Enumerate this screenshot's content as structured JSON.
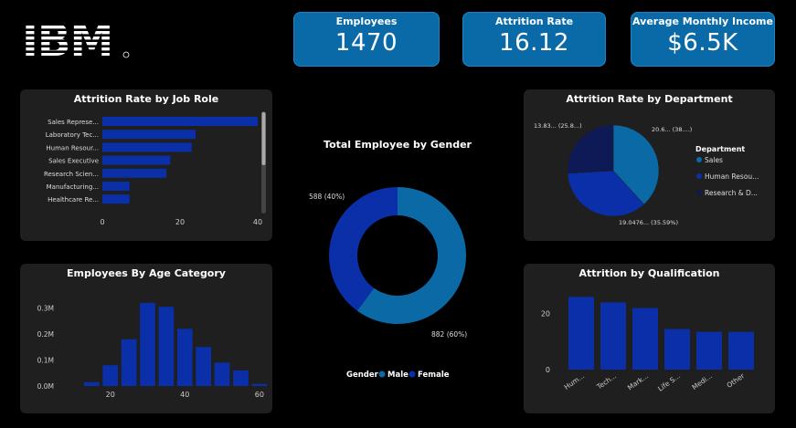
{
  "logo": {
    "text": "IBM"
  },
  "kpis": {
    "employees": {
      "label": "Employees",
      "value": "1470"
    },
    "attrition": {
      "label": "Attrition Rate",
      "value": "16.12"
    },
    "income": {
      "label": "Average Monthly Income",
      "value": "$6.5K"
    }
  },
  "colors": {
    "dark_blue": "#0a2fa8",
    "teal_blue": "#0b6aa6",
    "navy": "#0d1a55",
    "panel": "#1f1f1f",
    "kpi": "#0a6aa8"
  },
  "chart_data": [
    {
      "id": "job_role",
      "type": "bar",
      "orientation": "horizontal",
      "title": "Attrition Rate by Job Role",
      "categories": [
        "Sales Represe...",
        "Laboratory Tec...",
        "Human Resour...",
        "Sales Executive",
        "Research Scien...",
        "Manufacturing...",
        "Healthcare Re..."
      ],
      "values": [
        40,
        24,
        23,
        17.5,
        16.5,
        7,
        7
      ],
      "xticks": [
        "0",
        "20",
        "40"
      ],
      "xlim": [
        0,
        40
      ]
    },
    {
      "id": "gender",
      "type": "pie",
      "donut": true,
      "title": "Total Employee by Gender",
      "slices": [
        {
          "name": "Male",
          "value": 882,
          "label": "882 (60%)"
        },
        {
          "name": "Female",
          "value": 588,
          "label": "588 (40%)"
        }
      ],
      "legend_title": "Gender",
      "legend_position": "bottom"
    },
    {
      "id": "department",
      "type": "pie",
      "title": "Attrition Rate by Department",
      "slices": [
        {
          "name": "Sales",
          "value": 38.0,
          "label": "20.6... (38....)"
        },
        {
          "name": "Human Resou...",
          "value": 35.59,
          "label": "19.0476... (35.59%)"
        },
        {
          "name": "Research & D...",
          "value": 25.8,
          "label": "13.83... (25.8...)"
        }
      ],
      "legend_title": "Department",
      "legend_position": "right"
    },
    {
      "id": "age",
      "type": "bar",
      "title": "Employees By Age Category",
      "x": [
        15,
        20,
        25,
        30,
        35,
        40,
        45,
        50,
        55,
        60
      ],
      "values": [
        0.015,
        0.08,
        0.18,
        0.32,
        0.305,
        0.22,
        0.15,
        0.09,
        0.06,
        0.008
      ],
      "yticks": [
        "0.0M",
        "0.1M",
        "0.2M",
        "0.3M"
      ],
      "xticks": [
        "20",
        "40",
        "60"
      ],
      "ylim": [
        0,
        0.33
      ],
      "xlim": [
        11,
        62
      ]
    },
    {
      "id": "qualification",
      "type": "bar",
      "title": "Attrition by Qualification",
      "categories": [
        "Hum...",
        "Tech...",
        "Mark...",
        "Life S...",
        "Medi...",
        "Other"
      ],
      "values": [
        26,
        24,
        22,
        14.5,
        13.5,
        13.5
      ],
      "yticks": [
        "0",
        "20"
      ],
      "ylim": [
        0,
        30
      ]
    }
  ]
}
